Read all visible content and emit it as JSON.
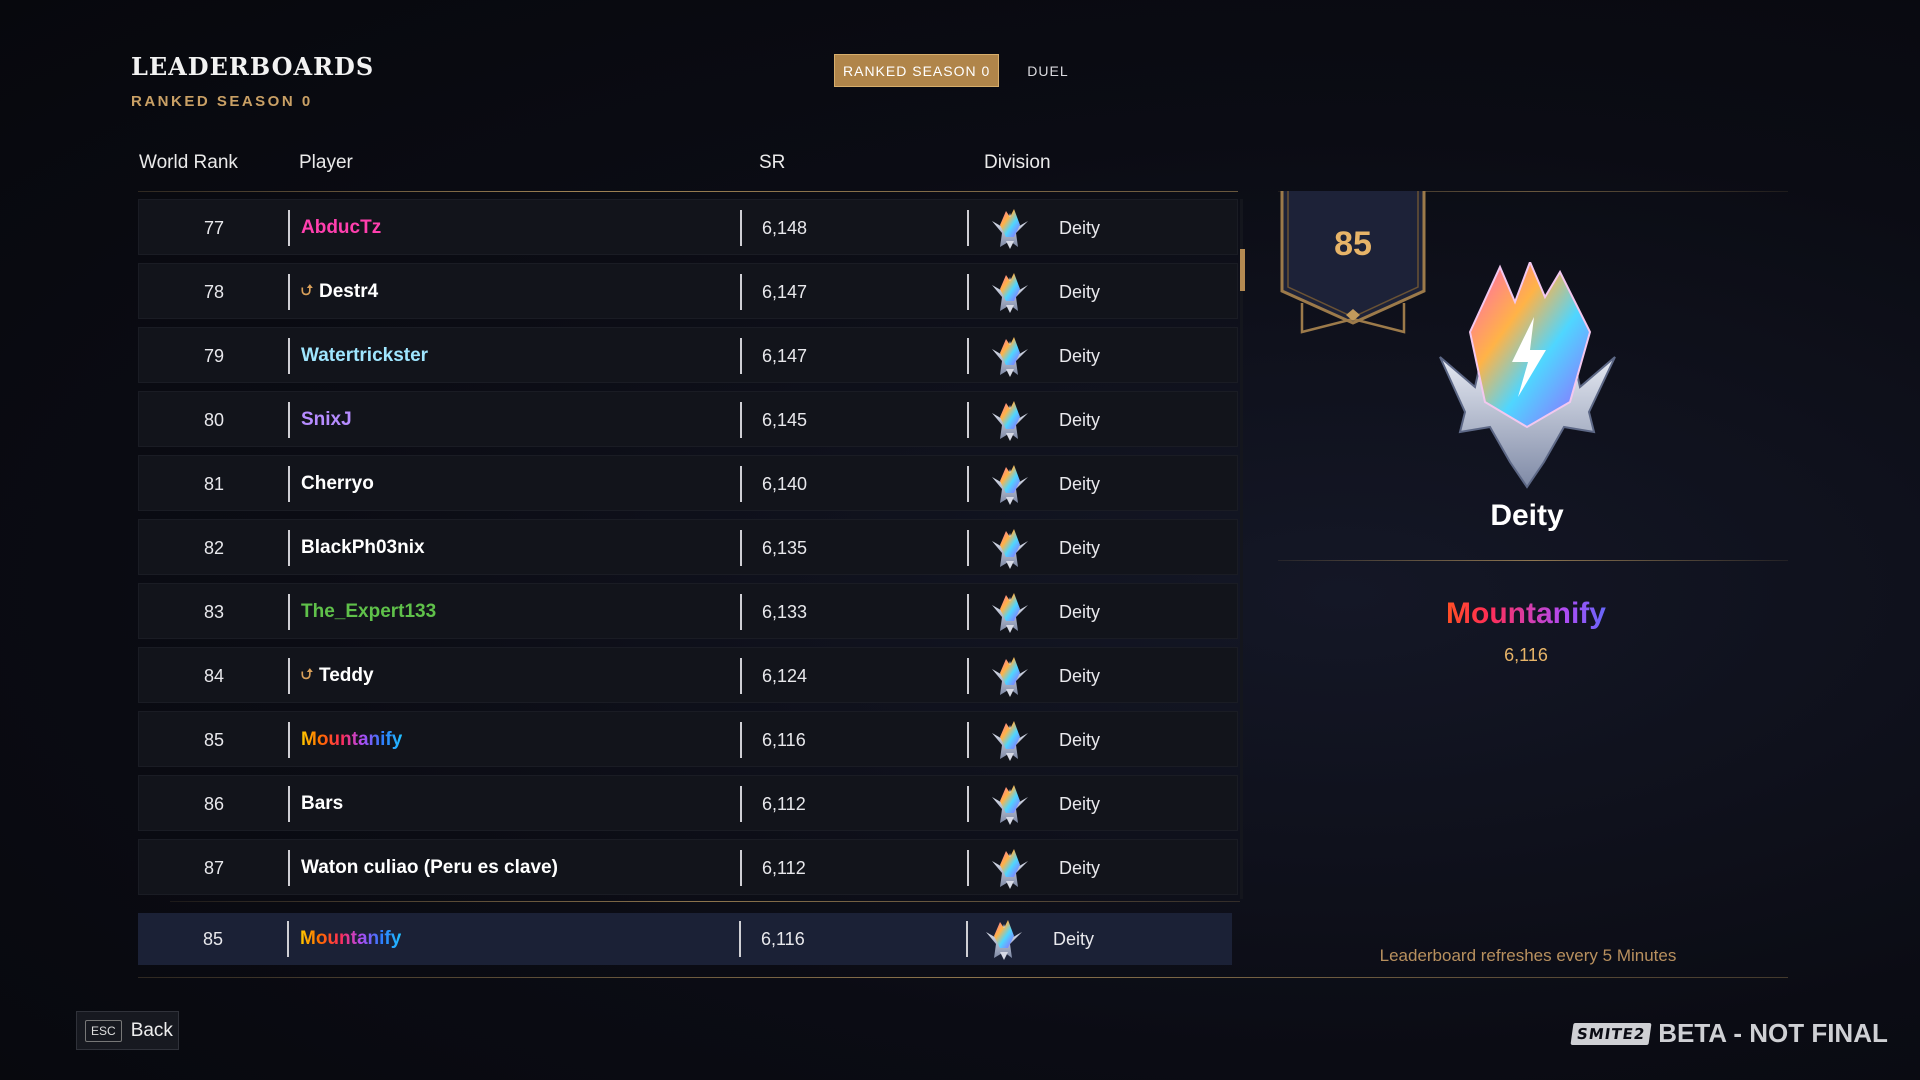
{
  "header": {
    "title": "LEADERBOARDS",
    "subtitle": "RANKED SEASON 0",
    "tabs": [
      {
        "label": "RANKED SEASON 0",
        "active": true
      },
      {
        "label": "DUEL",
        "active": false
      }
    ]
  },
  "columns": {
    "rank": "World Rank",
    "player": "Player",
    "sr": "SR",
    "division": "Division"
  },
  "rows": [
    {
      "rank": "77",
      "player": "AbducTz",
      "sr": "6,148",
      "division": "Deity",
      "name_color": "#ff3fae",
      "arrow": false
    },
    {
      "rank": "78",
      "player": "Destr4",
      "sr": "6,147",
      "division": "Deity",
      "name_color": "#ffffff",
      "arrow": true
    },
    {
      "rank": "79",
      "player": "Watertrickster",
      "sr": "6,147",
      "division": "Deity",
      "name_color": "#9fe6ff",
      "arrow": false
    },
    {
      "rank": "80",
      "player": "SnixJ",
      "sr": "6,145",
      "division": "Deity",
      "name_color": "#b68cff",
      "arrow": false
    },
    {
      "rank": "81",
      "player": "Cherryo",
      "sr": "6,140",
      "division": "Deity",
      "name_color": "#ffffff",
      "arrow": false
    },
    {
      "rank": "82",
      "player": "BlackPh03nix",
      "sr": "6,135",
      "division": "Deity",
      "name_color": "#ffffff",
      "arrow": false
    },
    {
      "rank": "83",
      "player": "The_Expert133",
      "sr": "6,133",
      "division": "Deity",
      "name_color": "#5fc14a",
      "arrow": false
    },
    {
      "rank": "84",
      "player": "Teddy",
      "sr": "6,124",
      "division": "Deity",
      "name_color": "#ffffff",
      "arrow": true
    },
    {
      "rank": "85",
      "player": "Mountanify",
      "sr": "6,116",
      "division": "Deity",
      "name_color": "rainbow",
      "arrow": false
    },
    {
      "rank": "86",
      "player": "Bars",
      "sr": "6,112",
      "division": "Deity",
      "name_color": "#ffffff",
      "arrow": false
    },
    {
      "rank": "87",
      "player": "Waton culiao (Peru es clave)",
      "sr": "6,112",
      "division": "Deity",
      "name_color": "#ffffff",
      "arrow": false
    }
  ],
  "my_row": {
    "rank": "85",
    "player": "Mountanify",
    "sr": "6,116",
    "division": "Deity"
  },
  "profile": {
    "rank": "85",
    "division": "Deity",
    "player": "Mountanify",
    "sr": "6,116"
  },
  "refresh_note": "Leaderboard refreshes every 5 Minutes",
  "footer": {
    "esc_key": "ESC",
    "back_label": "Back",
    "logo_text": "SMITE2",
    "beta_text": "BETA - NOT FINAL"
  },
  "icons": {
    "division_emblem": "deity-crystal-icon",
    "rising_arrow": "chevron-up-icon"
  },
  "colors": {
    "accent_gold": "#b0854a",
    "gold_text": "#e7b468",
    "highlight_row": "#1b2136"
  }
}
